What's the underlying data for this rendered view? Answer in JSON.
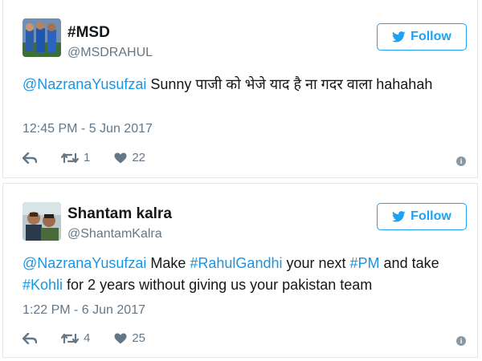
{
  "tweets": [
    {
      "display_name": "#MSD",
      "handle": "@MSDRAHUL",
      "follow_label": "Follow",
      "text_parts": [
        {
          "text": "@NazranaYusufzai",
          "link": true
        },
        {
          "text": " Sunny पाजी को भेजे याद है ना गदर वाला hahahah",
          "link": false
        }
      ],
      "timestamp": "12:45 PM - 5 Jun 2017",
      "retweets": "1",
      "likes": "22"
    },
    {
      "display_name": "Shantam kalra",
      "handle": "@ShantamKalra",
      "follow_label": "Follow",
      "text_parts": [
        {
          "text": "@NazranaYusufzai",
          "link": true
        },
        {
          "text": " Make ",
          "link": false
        },
        {
          "text": "#RahulGandhi",
          "link": true
        },
        {
          "text": " your next ",
          "link": false
        },
        {
          "text": "#PM",
          "link": true
        },
        {
          "text": " and take ",
          "link": false
        },
        {
          "text": "#Kohli",
          "link": true
        },
        {
          "text": " for 2 years without giving us your pakistan team",
          "link": false
        }
      ],
      "timestamp": "1:22 PM - 6 Jun 2017",
      "retweets": "4",
      "likes": "25"
    }
  ],
  "colors": {
    "link": "#1b95e0",
    "follow": "#1da1f2",
    "meta": "#657786"
  },
  "icons": {
    "reply": "reply-icon",
    "retweet": "retweet-icon",
    "like": "heart-icon",
    "info": "info-icon",
    "bird": "twitter-bird-icon"
  }
}
